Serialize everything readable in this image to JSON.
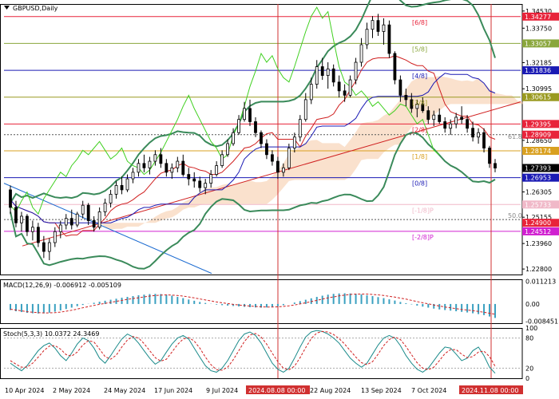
{
  "chart_data": {
    "type": "candlestick",
    "symbol_title": "GBPUSD,Daily",
    "macd_title": "MACD(12,26,9) -0.006912 -0.005109",
    "stoch_title": "Stoch(5,3,3) 10.0372 24.3469",
    "x_labels": [
      "10 Apr 2024",
      "2 May 2024",
      "24 May 2024",
      "17 Jun 2024",
      "9 Jul 2024",
      "22 Aug 2024",
      "13 Sep 2024",
      "7 Oct 2024"
    ],
    "highlight_x_labels": [
      "2024.08.08 00:00",
      "2024.11.08 00:00"
    ],
    "main_ylim": [
      1.2255,
      1.3485
    ],
    "price_ticks": [
      "1.34530",
      "1.33750",
      "1.32185",
      "1.30995",
      "1.28650",
      "1.26305",
      "1.25155",
      "1.23960",
      "1.22800"
    ],
    "murrey_levels": [
      {
        "label": "[6/8]",
        "value": 1.34277,
        "color": "#e8233a"
      },
      {
        "label": "[5/8]",
        "value": 1.33057,
        "color": "#8aa63c"
      },
      {
        "label": "[4/8]",
        "value": 1.31836,
        "color": "#1a1ab4"
      },
      {
        "label": "[3/8]",
        "value": 1.30615,
        "color": "#9a9a20"
      },
      {
        "label": "[2/8]",
        "value": 1.29395,
        "color": "#e8233a"
      },
      {
        "label": "[1/8]",
        "value": 1.28174,
        "color": "#d9a020"
      },
      {
        "label": "[0/8]",
        "value": 1.26953,
        "color": "#1a1ab4"
      },
      {
        "label": "[-1/8]P",
        "value": 1.25733,
        "color": "#f0b8c8"
      },
      {
        "label": "[-2/8]P",
        "value": 1.24512,
        "color": "#d020d0"
      }
    ],
    "price_tags": [
      {
        "text": "1.34277",
        "value": 1.34277,
        "color": "#e8233a"
      },
      {
        "text": "1.33057",
        "value": 1.33057,
        "color": "#8aa63c"
      },
      {
        "text": "1.31836",
        "value": 1.31836,
        "color": "#1a1ab4"
      },
      {
        "text": "1.30615",
        "value": 1.30615,
        "color": "#9a9a20"
      },
      {
        "text": "1.29395",
        "value": 1.29395,
        "color": "#e8233a"
      },
      {
        "text": "1.28909",
        "value": 1.28909,
        "color": "#e8233a"
      },
      {
        "text": "1.28174",
        "value": 1.28174,
        "color": "#d9a020"
      },
      {
        "text": "1.27393",
        "value": 1.27393,
        "color": "#000000"
      },
      {
        "text": "1.26953",
        "value": 1.26953,
        "color": "#1a1ab4"
      },
      {
        "text": "1.25733",
        "value": 1.25733,
        "color": "#f0b8c8"
      },
      {
        "text": "1.24900",
        "value": 1.249,
        "color": "#e8233a"
      },
      {
        "text": "1.24512",
        "value": 1.24512,
        "color": "#d020d0"
      }
    ],
    "fib_labels": [
      {
        "text": "61.8",
        "value": 1.2865
      },
      {
        "text": "50.0",
        "value": 1.2505
      }
    ],
    "ohlc": [
      [
        1.264,
        1.266,
        1.253,
        1.256
      ],
      [
        1.256,
        1.259,
        1.247,
        1.249
      ],
      [
        1.249,
        1.254,
        1.245,
        1.252
      ],
      [
        1.252,
        1.253,
        1.243,
        1.245
      ],
      [
        1.245,
        1.25,
        1.241,
        1.247
      ],
      [
        1.247,
        1.249,
        1.238,
        1.24
      ],
      [
        1.24,
        1.243,
        1.233,
        1.236
      ],
      [
        1.236,
        1.242,
        1.232,
        1.24
      ],
      [
        1.24,
        1.247,
        1.238,
        1.245
      ],
      [
        1.245,
        1.25,
        1.242,
        1.248
      ],
      [
        1.248,
        1.253,
        1.246,
        1.251
      ],
      [
        1.251,
        1.255,
        1.246,
        1.248
      ],
      [
        1.248,
        1.254,
        1.247,
        1.253
      ],
      [
        1.253,
        1.259,
        1.251,
        1.257
      ],
      [
        1.257,
        1.258,
        1.248,
        1.25
      ],
      [
        1.25,
        1.252,
        1.245,
        1.247
      ],
      [
        1.247,
        1.256,
        1.246,
        1.254
      ],
      [
        1.254,
        1.26,
        1.252,
        1.258
      ],
      [
        1.258,
        1.264,
        1.256,
        1.262
      ],
      [
        1.262,
        1.268,
        1.26,
        1.266
      ],
      [
        1.266,
        1.27,
        1.262,
        1.264
      ],
      [
        1.264,
        1.271,
        1.263,
        1.269
      ],
      [
        1.269,
        1.274,
        1.267,
        1.272
      ],
      [
        1.272,
        1.278,
        1.27,
        1.276
      ],
      [
        1.276,
        1.28,
        1.272,
        1.274
      ],
      [
        1.274,
        1.279,
        1.271,
        1.277
      ],
      [
        1.277,
        1.282,
        1.275,
        1.28
      ],
      [
        1.28,
        1.283,
        1.274,
        1.276
      ],
      [
        1.276,
        1.278,
        1.27,
        1.272
      ],
      [
        1.272,
        1.276,
        1.269,
        1.274
      ],
      [
        1.274,
        1.279,
        1.272,
        1.277
      ],
      [
        1.277,
        1.28,
        1.27,
        1.271
      ],
      [
        1.271,
        1.274,
        1.266,
        1.269
      ],
      [
        1.269,
        1.272,
        1.265,
        1.268
      ],
      [
        1.268,
        1.27,
        1.263,
        1.265
      ],
      [
        1.265,
        1.269,
        1.262,
        1.267
      ],
      [
        1.267,
        1.273,
        1.265,
        1.271
      ],
      [
        1.271,
        1.277,
        1.27,
        1.275
      ],
      [
        1.275,
        1.282,
        1.274,
        1.28
      ],
      [
        1.28,
        1.287,
        1.279,
        1.285
      ],
      [
        1.285,
        1.292,
        1.284,
        1.29
      ],
      [
        1.29,
        1.298,
        1.289,
        1.296
      ],
      [
        1.296,
        1.304,
        1.295,
        1.301
      ],
      [
        1.301,
        1.305,
        1.293,
        1.295
      ],
      [
        1.295,
        1.297,
        1.288,
        1.29
      ],
      [
        1.29,
        1.291,
        1.283,
        1.285
      ],
      [
        1.285,
        1.287,
        1.278,
        1.28
      ],
      [
        1.28,
        1.282,
        1.275,
        1.277
      ],
      [
        1.277,
        1.279,
        1.269,
        1.272
      ],
      [
        1.272,
        1.276,
        1.27,
        1.274
      ],
      [
        1.274,
        1.285,
        1.273,
        1.283
      ],
      [
        1.283,
        1.29,
        1.281,
        1.288
      ],
      [
        1.288,
        1.298,
        1.286,
        1.296
      ],
      [
        1.296,
        1.308,
        1.295,
        1.305
      ],
      [
        1.305,
        1.315,
        1.303,
        1.312
      ],
      [
        1.312,
        1.323,
        1.31,
        1.32
      ],
      [
        1.32,
        1.324,
        1.314,
        1.316
      ],
      [
        1.316,
        1.322,
        1.31,
        1.319
      ],
      [
        1.319,
        1.321,
        1.311,
        1.313
      ],
      [
        1.313,
        1.316,
        1.306,
        1.309
      ],
      [
        1.309,
        1.312,
        1.304,
        1.307
      ],
      [
        1.307,
        1.316,
        1.306,
        1.314
      ],
      [
        1.314,
        1.324,
        1.312,
        1.322
      ],
      [
        1.322,
        1.333,
        1.32,
        1.33
      ],
      [
        1.33,
        1.34,
        1.328,
        1.337
      ],
      [
        1.337,
        1.343,
        1.333,
        1.341
      ],
      [
        1.341,
        1.344,
        1.334,
        1.336
      ],
      [
        1.336,
        1.342,
        1.33,
        1.339
      ],
      [
        1.339,
        1.341,
        1.324,
        1.326
      ],
      [
        1.326,
        1.327,
        1.312,
        1.314
      ],
      [
        1.314,
        1.316,
        1.304,
        1.307
      ],
      [
        1.307,
        1.31,
        1.302,
        1.305
      ],
      [
        1.305,
        1.308,
        1.299,
        1.301
      ],
      [
        1.301,
        1.305,
        1.297,
        1.303
      ],
      [
        1.303,
        1.306,
        1.299,
        1.3
      ],
      [
        1.3,
        1.302,
        1.294,
        1.296
      ],
      [
        1.296,
        1.3,
        1.293,
        1.298
      ],
      [
        1.298,
        1.301,
        1.294,
        1.295
      ],
      [
        1.295,
        1.297,
        1.29,
        1.292
      ],
      [
        1.292,
        1.296,
        1.289,
        1.294
      ],
      [
        1.294,
        1.299,
        1.292,
        1.297
      ],
      [
        1.297,
        1.302,
        1.294,
        1.296
      ],
      [
        1.296,
        1.298,
        1.29,
        1.292
      ],
      [
        1.292,
        1.295,
        1.286,
        1.288
      ],
      [
        1.288,
        1.292,
        1.285,
        1.29
      ],
      [
        1.29,
        1.292,
        1.281,
        1.283
      ],
      [
        1.283,
        1.284,
        1.274,
        1.276
      ],
      [
        1.276,
        1.278,
        1.272,
        1.2739
      ]
    ],
    "macd": {
      "ylim": [
        -0.0095,
        0.0122
      ],
      "ticks": [
        "0.011213",
        "0.00",
        "-0.008451"
      ],
      "histogram": [
        -0.003,
        -0.0036,
        -0.004,
        -0.0044,
        -0.0046,
        -0.0047,
        -0.0046,
        -0.0043,
        -0.0038,
        -0.0032,
        -0.0025,
        -0.0018,
        -0.0011,
        -0.0005,
        0.0001,
        0.0006,
        0.0011,
        0.0016,
        0.0021,
        0.0026,
        0.0031,
        0.0035,
        0.0039,
        0.0043,
        0.0046,
        0.0049,
        0.005,
        0.0049,
        0.0046,
        0.0041,
        0.0035,
        0.0029,
        0.0022,
        0.0016,
        0.001,
        0.0005,
        0.0001,
        -0.0003,
        -0.0006,
        -0.0008,
        -0.001,
        -0.0012,
        -0.0014,
        -0.0016,
        -0.0017,
        -0.0018,
        -0.0017,
        -0.0015,
        -0.0011,
        -0.0006,
        0.0,
        0.0007,
        0.0014,
        0.0021,
        0.0028,
        0.0035,
        0.0041,
        0.0046,
        0.005,
        0.0052,
        0.0053,
        0.0052,
        0.005,
        0.0047,
        0.0043,
        0.0039,
        0.0034,
        0.0029,
        0.0023,
        0.0017,
        0.001,
        0.0004,
        -0.0002,
        -0.0008,
        -0.0013,
        -0.0018,
        -0.0023,
        -0.0027,
        -0.003,
        -0.0033,
        -0.0036,
        -0.0039,
        -0.0042,
        -0.0046,
        -0.005,
        -0.0055,
        -0.0062,
        -0.0069
      ],
      "signal": [
        -0.0026,
        -0.003,
        -0.0034,
        -0.0038,
        -0.0041,
        -0.0043,
        -0.0044,
        -0.0044,
        -0.0043,
        -0.004,
        -0.0036,
        -0.0031,
        -0.0025,
        -0.0019,
        -0.0013,
        -0.0007,
        -0.0002,
        0.0003,
        0.0008,
        0.0013,
        0.0018,
        0.0023,
        0.0027,
        0.0031,
        0.0035,
        0.0039,
        0.0042,
        0.0044,
        0.0045,
        0.0044,
        0.0042,
        0.0039,
        0.0035,
        0.003,
        0.0025,
        0.002,
        0.0015,
        0.001,
        0.0006,
        0.0002,
        -0.0002,
        -0.0005,
        -0.0008,
        -0.001,
        -0.0012,
        -0.0014,
        -0.0015,
        -0.0015,
        -0.0014,
        -0.0012,
        -0.0009,
        -0.0005,
        0.0,
        0.0006,
        0.0012,
        0.0018,
        0.0024,
        0.003,
        0.0035,
        0.004,
        0.0044,
        0.0047,
        0.0049,
        0.0049,
        0.0049,
        0.0047,
        0.0045,
        0.0042,
        0.0038,
        0.0034,
        0.0029,
        0.0024,
        0.0018,
        0.0012,
        0.0006,
        0.0001,
        -0.0005,
        -0.001,
        -0.0015,
        -0.0019,
        -0.0023,
        -0.0027,
        -0.003,
        -0.0033,
        -0.0037,
        -0.0041,
        -0.0046,
        -0.0051
      ]
    },
    "stoch": {
      "ylim": [
        0,
        100
      ],
      "ticks": [
        "100",
        "80",
        "20",
        "0"
      ],
      "main": [
        30,
        22,
        15,
        25,
        40,
        55,
        65,
        70,
        60,
        45,
        35,
        50,
        68,
        80,
        75,
        60,
        40,
        30,
        45,
        62,
        78,
        88,
        82,
        70,
        55,
        40,
        28,
        35,
        52,
        68,
        80,
        85,
        78,
        60,
        42,
        25,
        15,
        12,
        20,
        35,
        55,
        75,
        88,
        92,
        85,
        70,
        50,
        30,
        18,
        12,
        20,
        40,
        62,
        82,
        92,
        95,
        93,
        88,
        80,
        70,
        55,
        40,
        30,
        22,
        30,
        48,
        66,
        80,
        85,
        80,
        65,
        45,
        30,
        18,
        12,
        20,
        35,
        50,
        62,
        60,
        48,
        35,
        40,
        55,
        62,
        45,
        22,
        10
      ],
      "signal": [
        35,
        28,
        22,
        22,
        30,
        42,
        55,
        64,
        65,
        58,
        47,
        44,
        52,
        66,
        75,
        72,
        58,
        43,
        38,
        46,
        62,
        76,
        83,
        80,
        69,
        55,
        41,
        34,
        38,
        52,
        67,
        78,
        81,
        74,
        60,
        42,
        27,
        17,
        16,
        22,
        37,
        55,
        73,
        86,
        89,
        82,
        68,
        50,
        33,
        20,
        17,
        24,
        41,
        61,
        79,
        90,
        93,
        92,
        87,
        79,
        68,
        55,
        42,
        31,
        27,
        33,
        48,
        65,
        77,
        82,
        77,
        63,
        47,
        31,
        20,
        17,
        22,
        35,
        49,
        57,
        57,
        48,
        41,
        43,
        52,
        54,
        43,
        24
      ]
    }
  }
}
